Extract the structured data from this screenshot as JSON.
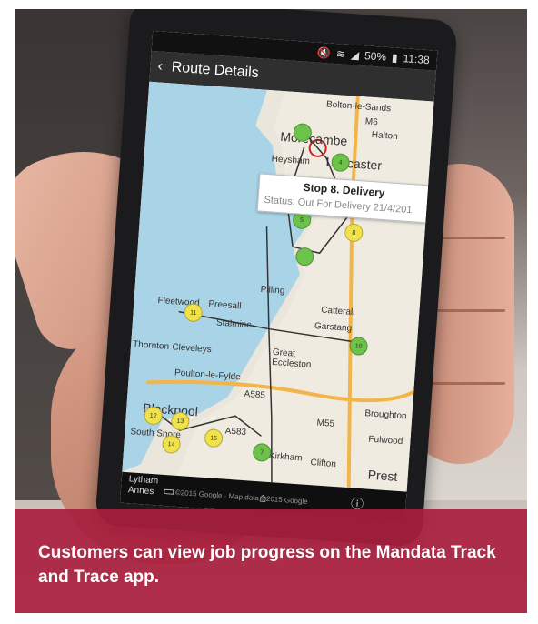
{
  "status_bar": {
    "battery": "50%",
    "time": "11:38"
  },
  "app_bar": {
    "back_icon": "chevron-left-icon",
    "title": "Route Details"
  },
  "map_labels": {
    "bolton": "Bolton-le-Sands",
    "m6": "M6",
    "halton": "Halton",
    "morecambe": "Morecambe",
    "heysham": "Heysham",
    "lancaster": "Lancaster",
    "pilling": "Pilling",
    "fleetwood": "Fleetwood",
    "preesall": "Preesall",
    "stalmine": "Stalmine",
    "thornton": "Thornton-Cleveleys",
    "great_eccleston": "Great\nEccleston",
    "poulton": "Poulton-le-Fylde",
    "a585": "A585",
    "blackpool": "Blackpool",
    "south_shore": "South Shore",
    "kirkham": "Kirkham",
    "m55": "M55",
    "broughton": "Broughton",
    "fulwood": "Fulwood",
    "clifton": "Clifton",
    "preston": "Prest",
    "catterall": "Catterall",
    "garstang": "Garstang",
    "a583": "A583",
    "lytham": "Lytham",
    "annes": "Annes"
  },
  "info_window": {
    "title": "Stop 8. Delivery",
    "status": "Status: Out For Delivery 21/4/201"
  },
  "stops": [
    {
      "num": "",
      "color": "green"
    },
    {
      "num": "4",
      "color": "green"
    },
    {
      "num": "5",
      "color": "green"
    },
    {
      "num": "8",
      "color": "yellow"
    },
    {
      "num": "",
      "color": "green"
    },
    {
      "num": "11",
      "color": "yellow"
    },
    {
      "num": "10",
      "color": "green"
    },
    {
      "num": "12",
      "color": "yellow"
    },
    {
      "num": "13",
      "color": "yellow"
    },
    {
      "num": "14",
      "color": "yellow"
    },
    {
      "num": "15",
      "color": "yellow"
    },
    {
      "num": "7",
      "color": "green"
    }
  ],
  "map_footer": "©2015 Google · Map data ©2015 Google",
  "caption": "Customers can view job progress on the Mandata Track and Trace app.",
  "colors": {
    "caption_bg": "#a81e3e",
    "stop_green": "#6cc24a",
    "stop_yellow": "#f0e24a"
  }
}
